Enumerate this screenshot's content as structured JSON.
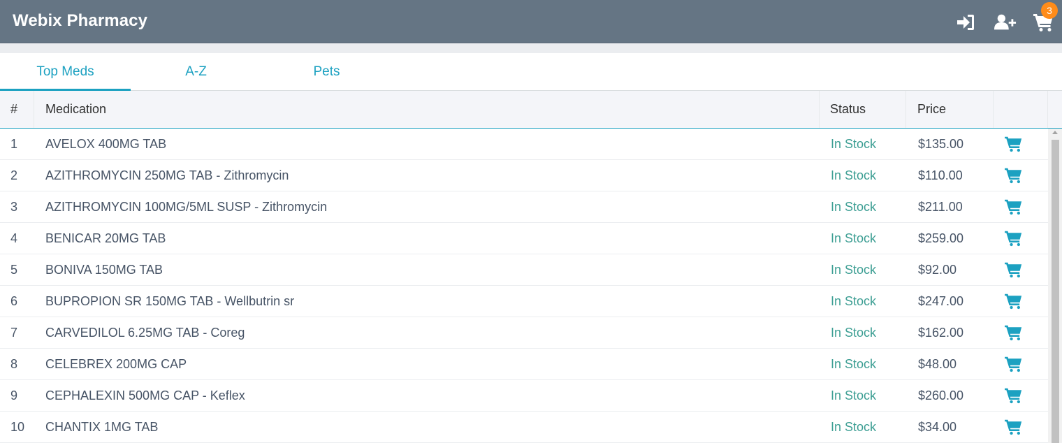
{
  "app": {
    "title": "Webix Pharmacy",
    "cart_count": "3"
  },
  "toolbar": {
    "icons": [
      "sign-in-icon",
      "user-plus-icon",
      "shopping-cart-icon"
    ]
  },
  "tabs": [
    {
      "label": "Top Meds",
      "active": true
    },
    {
      "label": "A-Z",
      "active": false
    },
    {
      "label": "Pets",
      "active": false
    }
  ],
  "table": {
    "columns": [
      "#",
      "Medication",
      "Status",
      "Price"
    ],
    "rows": [
      {
        "index": "1",
        "medication": "AVELOX 400MG TAB",
        "status": "In Stock",
        "price": "$135.00"
      },
      {
        "index": "2",
        "medication": "AZITHROMYCIN 250MG TAB - Zithromycin",
        "status": "In Stock",
        "price": "$110.00"
      },
      {
        "index": "3",
        "medication": "AZITHROMYCIN 100MG/5ML SUSP - Zithromycin",
        "status": "In Stock",
        "price": "$211.00"
      },
      {
        "index": "4",
        "medication": "BENICAR 20MG TAB",
        "status": "In Stock",
        "price": "$259.00"
      },
      {
        "index": "5",
        "medication": "BONIVA 150MG TAB",
        "status": "In Stock",
        "price": "$92.00"
      },
      {
        "index": "6",
        "medication": "BUPROPION SR 150MG TAB - Wellbutrin sr",
        "status": "In Stock",
        "price": "$247.00"
      },
      {
        "index": "7",
        "medication": "CARVEDILOL 6.25MG TAB - Coreg",
        "status": "In Stock",
        "price": "$162.00"
      },
      {
        "index": "8",
        "medication": "CELEBREX 200MG CAP",
        "status": "In Stock",
        "price": "$48.00"
      },
      {
        "index": "9",
        "medication": "CEPHALEXIN 500MG CAP - Keflex",
        "status": "In Stock",
        "price": "$260.00"
      },
      {
        "index": "10",
        "medication": "CHANTIX 1MG TAB",
        "status": "In Stock",
        "price": "$34.00"
      }
    ]
  },
  "colors": {
    "toolbar": "#657584",
    "accent": "#1ca1c1",
    "badge": "#ff8c1a",
    "status": "#3c9e93"
  }
}
